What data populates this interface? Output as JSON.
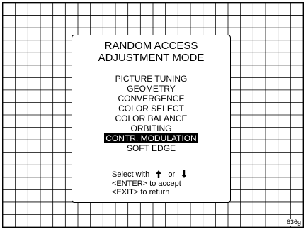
{
  "menu": {
    "title_line1": "RANDOM ACCESS",
    "title_line2": "ADJUSTMENT MODE",
    "items": [
      {
        "label": "PICTURE TUNING"
      },
      {
        "label": "GEOMETRY"
      },
      {
        "label": "CONVERGENCE"
      },
      {
        "label": "COLOR SELECT"
      },
      {
        "label": "COLOR BALANCE"
      },
      {
        "label": "ORBITING"
      },
      {
        "label": "CONTR. MODULATION",
        "selected": true
      },
      {
        "label": "SOFT EDGE"
      }
    ],
    "selected_item": "CONTR. MODULATION"
  },
  "help": {
    "select_with": "Select with",
    "or": "or",
    "up_icon": "arrow-up-icon",
    "down_icon": "arrow-down-icon",
    "enter_text": "<ENTER> to accept",
    "exit_text": "<EXIT> to return"
  },
  "figure_code": "636g"
}
